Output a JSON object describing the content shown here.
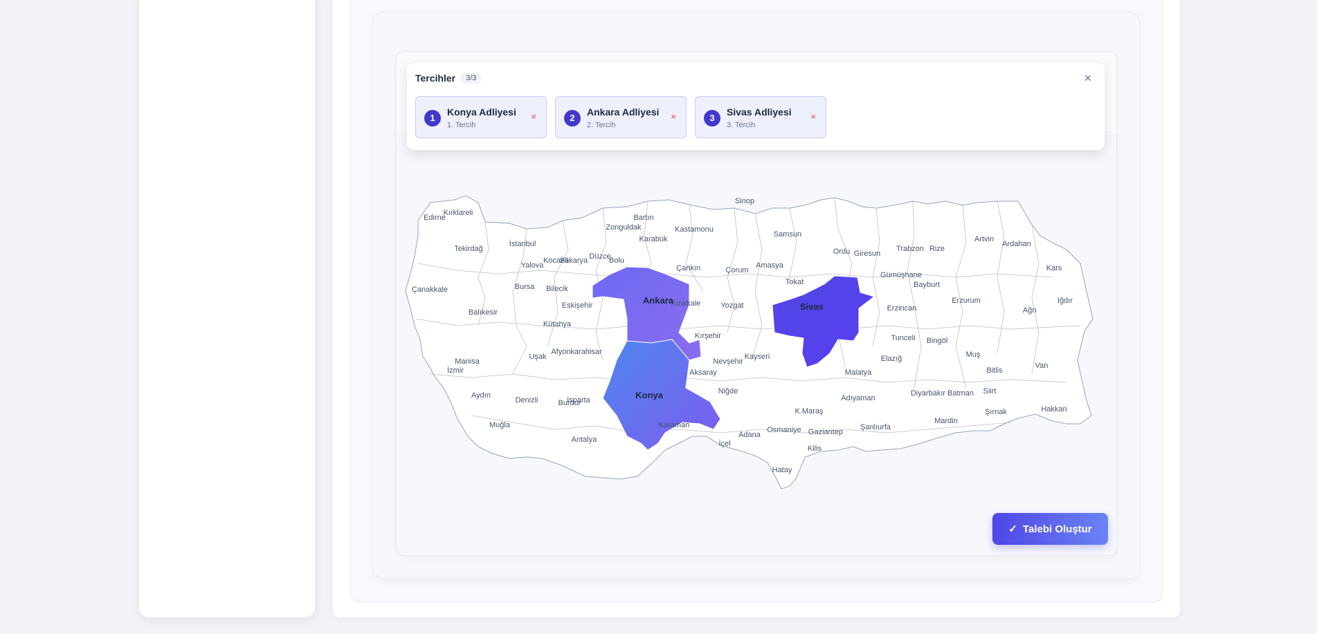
{
  "preferences": {
    "title": "Tercihler",
    "count": "3/3",
    "items": [
      {
        "rank": "1",
        "name": "Konya Adliyesi",
        "subtitle": "1. Tercih"
      },
      {
        "rank": "2",
        "name": "Ankara Adliyesi",
        "subtitle": "2. Tercih"
      },
      {
        "rank": "3",
        "name": "Sivas Adliyesi",
        "subtitle": "3. Tercih"
      }
    ],
    "remove_glyph": "×",
    "close_glyph": "×"
  },
  "map": {
    "selected_provinces": [
      "Konya",
      "Ankara",
      "Sivas"
    ],
    "province_labels": [
      "Sinop",
      "Edirne",
      "Kırklareli",
      "Bartın",
      "Zonguldak",
      "Kastamonu",
      "Samsun",
      "Karabük",
      "İstanbul",
      "Tekirdağ",
      "Artvin",
      "Ardahan",
      "Trabzon",
      "Rize",
      "Ordu",
      "Giresun",
      "Düzce",
      "Kocaeli",
      "Sakarya",
      "Bolu",
      "Yalova",
      "Çankırı",
      "Çorum",
      "Amasya",
      "Kars",
      "Gümüşhane",
      "Tokat",
      "Bayburt",
      "Çanakkale",
      "Bursa",
      "Bilecik",
      "Kırıkkale",
      "Iğdır",
      "Eskişehir",
      "Yozgat",
      "Erzurum",
      "Erzincan",
      "Ağrı",
      "Balıkesir",
      "Kütahya",
      "Kırşehir",
      "Tunceli",
      "Bingöl",
      "Afyonkarahisar",
      "Uşak",
      "Kayseri",
      "Nevşehir",
      "Manisa",
      "Elazığ",
      "Muş",
      "İzmir",
      "Aksaray",
      "Malatya",
      "Bitlis",
      "Van",
      "Aydın",
      "Denizli",
      "Isparta",
      "Burdur",
      "Niğde",
      "Adıyaman",
      "Diyarbakır",
      "Batman",
      "Siirt",
      "Şırnak",
      "Hakkari",
      "Muğla",
      "K.Maraş",
      "Mardin",
      "Karaman",
      "Şanlıurfa",
      "Adana",
      "Osmaniye",
      "Gaziantep",
      "Antalya",
      "İçel",
      "Kilis",
      "Hatay",
      "Konya",
      "Ankara",
      "Sivas"
    ]
  },
  "actions": {
    "create_label": "Talebi Oluştur",
    "create_icon": "check-icon"
  },
  "colors": {
    "accent": "#4f46e5",
    "chip_bg": "#eef0fe",
    "remove": "#ef4444"
  }
}
